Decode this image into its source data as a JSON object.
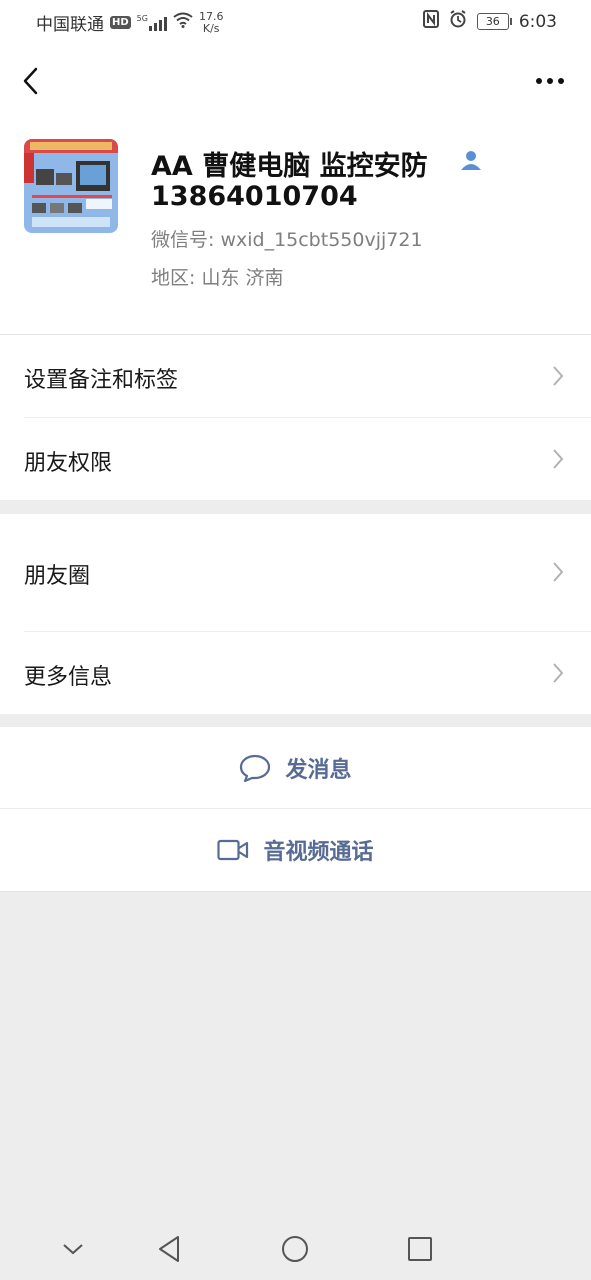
{
  "status_bar": {
    "carrier": "中国联通",
    "hd": "HD",
    "network": "5G",
    "speed_value": "17.6",
    "speed_unit": "K/s",
    "battery": "36",
    "time": "6:03"
  },
  "profile": {
    "name": "AA 曹健电脑 监控安防",
    "phone": "13864010704",
    "wechat_id": "微信号:  wxid_15cbt550vjj721",
    "region": "地区:  山东  济南"
  },
  "menu": {
    "remark_tags": "设置备注和标签",
    "friend_permissions": "朋友权限",
    "moments": "朋友圈",
    "more_info": "更多信息"
  },
  "actions": {
    "send_message": "发消息",
    "av_call": "音视频通话"
  },
  "colors": {
    "link": "#576b95",
    "background": "#ededed",
    "icon_blue": "#5b8fd4"
  }
}
